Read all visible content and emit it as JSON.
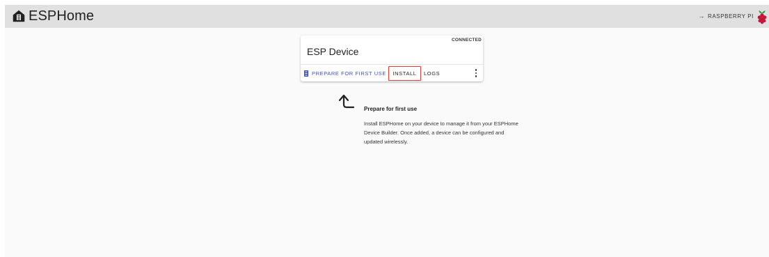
{
  "header": {
    "brand": "ESPHome",
    "device_link": "RASPBERRY PI",
    "arrow": "→"
  },
  "card": {
    "status": "CONNECTED",
    "title": "ESP Device",
    "actions": {
      "prepare": "PREPARE FOR FIRST USE",
      "install": "INSTALL",
      "logs": "LOGS"
    }
  },
  "hint": {
    "title": "Prepare for first use",
    "body": "Install ESPHome on your device to manage it from your ESPHome Device Builder. Once added, a device can be configured and updated wirelessly."
  },
  "colors": {
    "accent": "#3f51b5",
    "highlight": "#e53935",
    "topbar": "#e0e0e0"
  },
  "icons": [
    "esphome-logo-icon",
    "arrow-right-icon",
    "raspberry-pi-icon",
    "chip-icon",
    "more-vert-icon",
    "curved-arrow-icon"
  ]
}
